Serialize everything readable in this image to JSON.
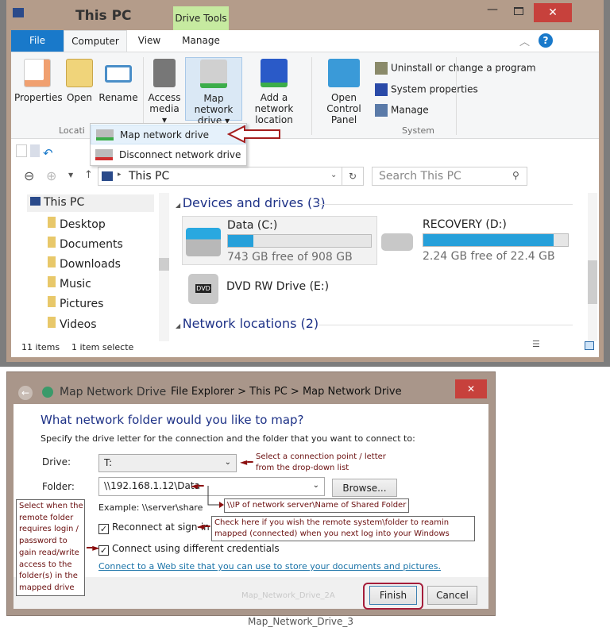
{
  "explorer": {
    "title": "This PC",
    "context_tab": "Drive Tools",
    "tabs": [
      "File",
      "Computer",
      "View",
      "Manage"
    ],
    "ribbon": {
      "location_buttons": [
        "Properties",
        "Open",
        "Rename"
      ],
      "network_buttons": [
        {
          "l1": "Access",
          "l2": "media ▾"
        },
        {
          "l1": "Map network",
          "l2": "drive ▾"
        },
        {
          "l1": "Add a network",
          "l2": "location"
        }
      ],
      "control_panel": {
        "l1": "Open Control",
        "l2": "Panel"
      },
      "system_items": [
        "Uninstall or change a program",
        "System properties",
        "Manage"
      ],
      "group_location": "Locati",
      "group_system": "System"
    },
    "dropdown": [
      "Map network drive",
      "Disconnect network drive"
    ],
    "address": "This PC",
    "search_placeholder": "Search This PC",
    "nav_items": [
      "This PC",
      "Desktop",
      "Documents",
      "Downloads",
      "Music",
      "Pictures",
      "Videos"
    ],
    "devices_header": "Devices and drives (3)",
    "drives": [
      {
        "name": "Data (C:)",
        "free": "743 GB free of 908 GB",
        "used_pct": 18
      },
      {
        "name": "RECOVERY (D:)",
        "free": "2.24 GB free of 22.4 GB",
        "used_pct": 90
      }
    ],
    "dvd": "DVD RW Drive (E:)",
    "network_header": "Network locations (2)",
    "status": {
      "items": "11 items",
      "selected": "1 item selecte"
    }
  },
  "dialog": {
    "title": "Map Network Drive",
    "breadcrumb": "File Explorer > This PC > Map Network Drive",
    "heading": "What network folder would you like to map?",
    "instruction": "Specify the drive letter for the connection and the folder that you want to connect to:",
    "drive_label": "Drive:",
    "drive_value": "T:",
    "folder_label": "Folder:",
    "folder_value": "\\\\192.168.1.12\\Data",
    "browse": "Browse...",
    "example": "Example: \\\\server\\share",
    "reconnect": "Reconnect at sign-in",
    "credentials": "Connect using different credentials",
    "link": "Connect to a Web site that you can use to store your documents and pictures.",
    "watermark": "Map_Network_Drive_2A",
    "finish": "Finish",
    "cancel": "Cancel"
  },
  "annotations": {
    "drive_note": [
      "Select a connection point / letter",
      "from the drop-down list"
    ],
    "folder_note": "\\\\IP of network server\\Name of Shared Folder",
    "reconnect_note": [
      "Check here if you wish the remote system\\folder to reamin",
      "mapped (connected) when you next log into your Windows"
    ],
    "credentials_note": [
      "Select when the",
      "remote folder",
      "requires  login /",
      "password to",
      "gain read/write",
      "access to the",
      "folder(s) in the",
      "mapped drive"
    ]
  },
  "caption": "Map_Network_Drive_3",
  "colors": {
    "file_tab": "#1979ca",
    "drive_tools": "#c6eaa0",
    "close": "#c7413c",
    "progress": "#26a0da",
    "annotation": "#8b0f0f"
  }
}
